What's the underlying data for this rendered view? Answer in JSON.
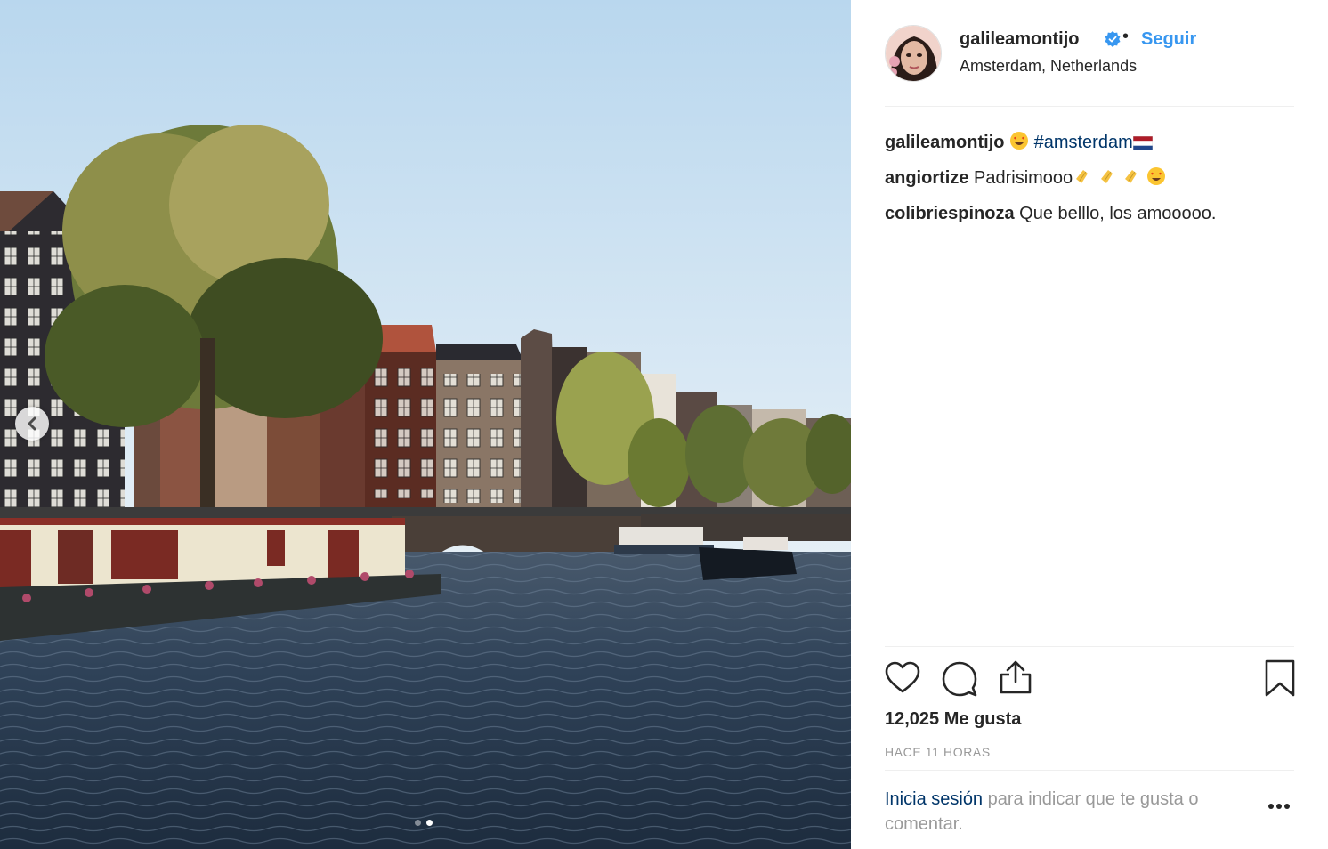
{
  "post": {
    "username": "galileamontijo",
    "follow_label": "Seguir",
    "separator": "•",
    "location": "Amsterdam, Netherlands"
  },
  "comments": [
    {
      "author": "galileamontijo",
      "text_parts": [
        "😍",
        "#amsterdam",
        "🇳🇱"
      ]
    },
    {
      "author": "angiortize",
      "text": "Padrisimooo👏 👏 👏 😍"
    },
    {
      "author": "colibriespinoza",
      "text": "Que belllo, los amooooo."
    }
  ],
  "caption": {
    "author": "galileamontijo",
    "emoji": "😍",
    "hashtag": "#amsterdam"
  },
  "comment2": {
    "author": "angiortize",
    "text": "Padrisimooo"
  },
  "comment3": {
    "author": "colibriespinoza",
    "text": "Que belllo, los amooooo."
  },
  "stats": {
    "likes": "12,025 Me gusta",
    "time": "HACE 11 HORAS"
  },
  "footer": {
    "login_link": "Inicia sesión",
    "login_rest": " para indicar que te gusta o comentar."
  },
  "carousel": {
    "current": 2,
    "total": 2
  },
  "icons": {
    "like": "heart-icon",
    "comment": "comment-icon",
    "share": "share-icon",
    "save": "bookmark-icon",
    "more": "more-options-icon",
    "verified": "verified-badge-icon",
    "prev": "chevron-left-icon"
  },
  "colors": {
    "link": "#3897f0",
    "hashtag": "#003569",
    "muted": "#999999",
    "text": "#262626"
  }
}
